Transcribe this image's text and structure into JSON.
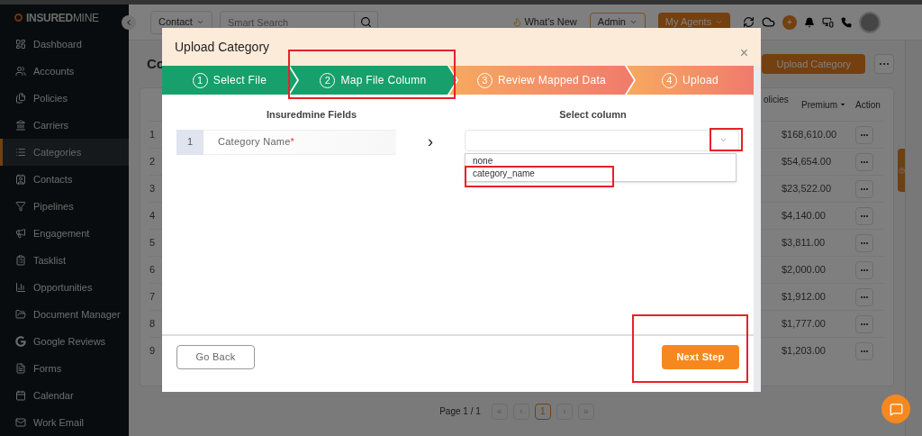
{
  "sidebar": {
    "logo": "**INSURED**MINE",
    "items": [
      {
        "label": "Dashboard",
        "selected": false
      },
      {
        "label": "Accounts",
        "selected": false
      },
      {
        "label": "Policies",
        "selected": false
      },
      {
        "label": "Carriers",
        "selected": false
      },
      {
        "label": "Categories",
        "selected": true
      },
      {
        "label": "Contacts",
        "selected": false
      },
      {
        "label": "Pipelines",
        "selected": false
      },
      {
        "label": "Engagement",
        "selected": false
      },
      {
        "label": "Tasklist",
        "selected": false
      },
      {
        "label": "Opportunities",
        "selected": false
      },
      {
        "label": "Document Manager",
        "selected": false
      },
      {
        "label": "Google Reviews",
        "selected": false
      },
      {
        "label": "Forms",
        "selected": false
      },
      {
        "label": "Calendar",
        "selected": false
      },
      {
        "label": "Work Email",
        "selected": false
      }
    ]
  },
  "header": {
    "search_scope": "Contact",
    "search": {
      "placeholder": "Smart Search"
    },
    "whats_new": "What's New",
    "role": "Admin",
    "agents": "My Agents",
    "add": "+"
  },
  "page": {
    "title": "Co",
    "actions": [
      "Upload Category"
    ],
    "table": {
      "columns": [
        "olicies",
        "Premium",
        "Action"
      ],
      "rows": [
        {
          "number": "1",
          "premium": "$168,610.00"
        },
        {
          "number": "2",
          "premium": "$54,654.00"
        },
        {
          "number": "3",
          "premium": "$23,522.00"
        },
        {
          "number": "4",
          "premium": "$4,140.00"
        },
        {
          "number": "5",
          "premium": "$3,811.00"
        },
        {
          "number": "6",
          "premium": "$2,000.00"
        },
        {
          "number": "7",
          "premium": "$1,912.00"
        },
        {
          "number": "8",
          "premium": "$1,777.00"
        },
        {
          "number": "9",
          "premium": "$1,203.00"
        }
      ]
    },
    "pagination": {
      "label": "Page 1 / 1",
      "first": "«",
      "prev": "‹",
      "pages": [
        {
          "label": "1",
          "selected": true
        }
      ],
      "next": "›",
      "last": "»"
    }
  },
  "modal": {
    "title": "Upload Category",
    "close": "×",
    "steps": [
      {
        "number": "1",
        "label": "Select File",
        "completed": true
      },
      {
        "number": "2",
        "label": "Map File Column",
        "completed": true
      },
      {
        "number": "3",
        "label": "Review Mapped Data",
        "completed": false
      },
      {
        "number": "4",
        "label": "Upload",
        "completed": false
      }
    ],
    "left_heading": "Insuredmine Fields",
    "right_heading": "Select column",
    "mappings": [
      {
        "number": "1",
        "field": "Category Name",
        "required_mark": "*",
        "arrow": "›",
        "options": [
          "none",
          "category_name"
        ]
      }
    ],
    "back_button": "Go Back",
    "next_button": "Next Step"
  }
}
